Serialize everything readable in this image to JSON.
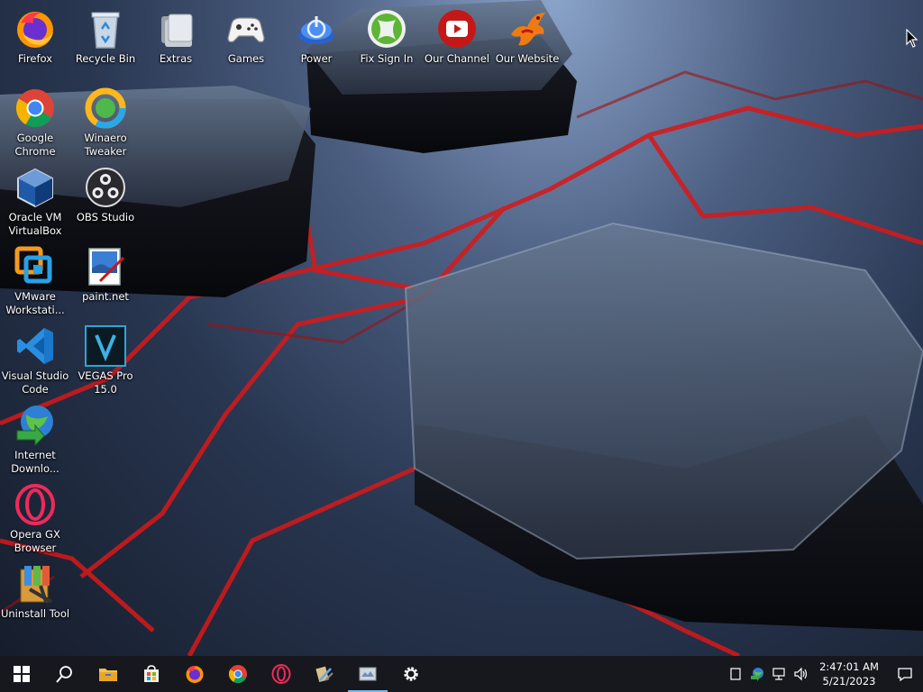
{
  "desktop": {
    "icons": {
      "firefox": "Firefox",
      "recycle_bin": "Recycle Bin",
      "extras": "Extras",
      "games": "Games",
      "power": "Power",
      "fix_sign_in": "Fix Sign In",
      "our_channel": "Our Channel",
      "our_website": "Our Website",
      "google_chrome": "Google\nChrome",
      "winaero_tweaker": "Winaero\nTweaker",
      "virtualbox": "Oracle VM\nVirtualBox",
      "obs_studio": "OBS Studio",
      "vmware": "VMware\nWorkstati...",
      "paint_net": "paint.net",
      "vscode": "Visual Studio\nCode",
      "vegas_pro": "VEGAS Pro\n15.0",
      "idm": "Internet\nDownlo...",
      "opera_gx": "Opera GX\nBrowser",
      "uninstall_tool": "Uninstall Tool"
    }
  },
  "taskbar": {
    "items": [
      "windows-start",
      "search",
      "file-explorer",
      "microsoft-store",
      "firefox",
      "google-chrome",
      "opera-gx",
      "winaero-tweaker",
      "snipping-tool",
      "settings"
    ],
    "active_item": "snipping-tool",
    "tray_icons": [
      "keyboard-layout",
      "network-status",
      "network",
      "volume"
    ],
    "clock": {
      "time": "2:47:01 AM",
      "date": "5/21/2023"
    }
  },
  "colors": {
    "taskbar_bg": "#17181d",
    "accent": "#76b9ed",
    "wallpaper_neon": "#e01818"
  }
}
